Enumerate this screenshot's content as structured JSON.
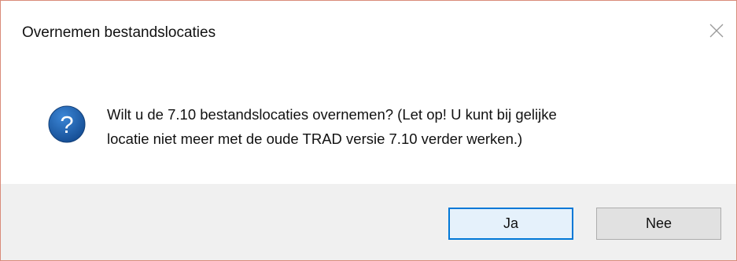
{
  "dialog": {
    "title": "Overnemen bestandslocaties",
    "message_line1": "Wilt u de 7.10 bestandslocaties overnemen? (Let op! U kunt bij gelijke",
    "message_line2": "locatie niet meer met de oude TRAD versie 7.10 verder werken.)",
    "icon": "question-icon",
    "close_icon": "close-icon"
  },
  "buttons": {
    "yes_label": "Ja",
    "no_label": "Nee"
  },
  "colors": {
    "border": "#d98b7a",
    "icon_blue": "#1e5fa8",
    "default_button_border": "#0078d7",
    "footer_background": "#f0f0f0"
  }
}
